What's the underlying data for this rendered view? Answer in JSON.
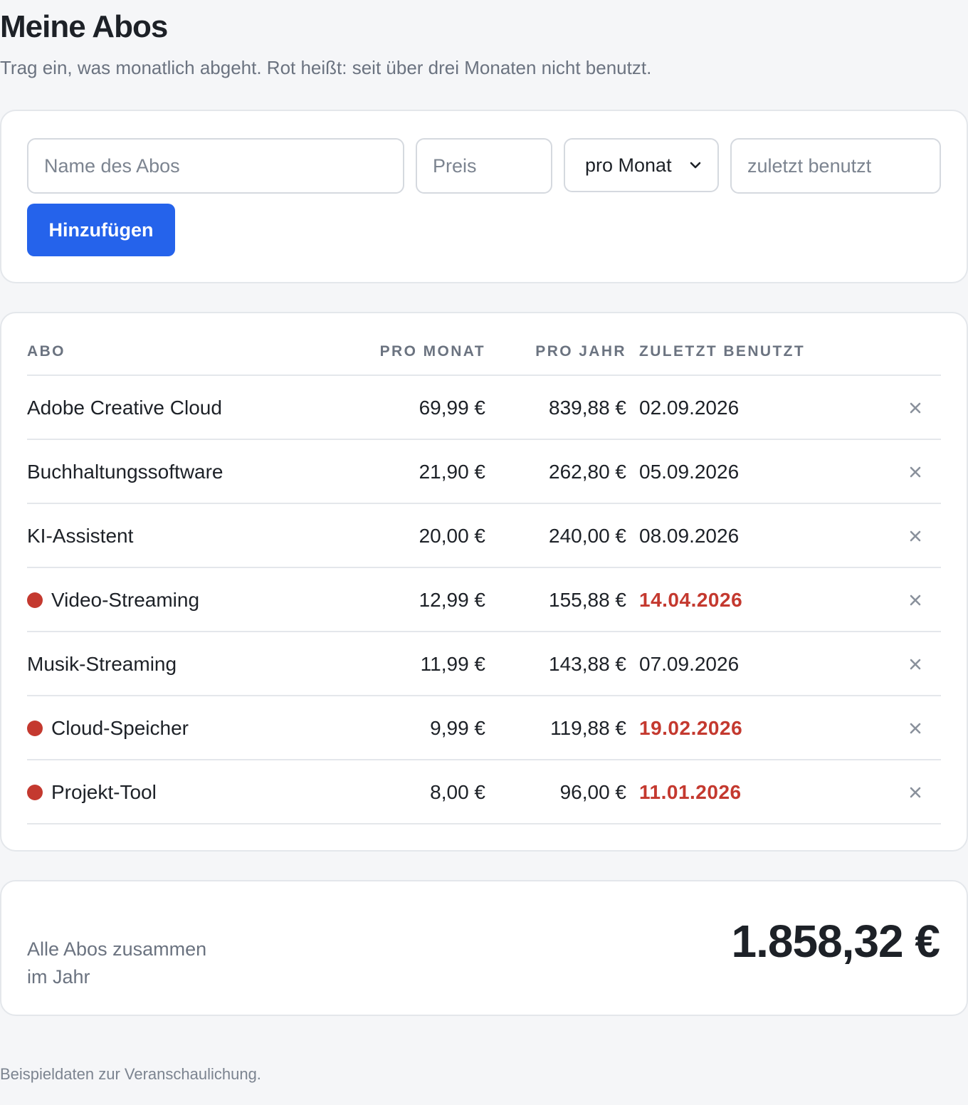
{
  "header": {
    "title": "Meine Abos",
    "subtitle": "Trag ein, was monatlich abgeht. Rot heißt: seit über drei Monaten nicht benutzt."
  },
  "form": {
    "name_placeholder": "Name des Abos",
    "price_placeholder": "Preis",
    "interval_selected": "pro Monat",
    "last_used_placeholder": "zuletzt benutzt",
    "add_label": "Hinzufügen"
  },
  "table": {
    "headers": {
      "abo": "ABO",
      "per_month": "PRO MONAT",
      "per_year": "PRO JAHR",
      "last_used": "ZULETZT BENUTZT"
    },
    "rows": [
      {
        "name": "Adobe Creative Cloud",
        "per_month": "69,99 €",
        "per_year": "839,88 €",
        "last_used": "02.09.2026",
        "stale": false
      },
      {
        "name": "Buchhaltungssoftware",
        "per_month": "21,90 €",
        "per_year": "262,80 €",
        "last_used": "05.09.2026",
        "stale": false
      },
      {
        "name": "KI-Assistent",
        "per_month": "20,00 €",
        "per_year": "240,00 €",
        "last_used": "08.09.2026",
        "stale": false
      },
      {
        "name": "Video-Streaming",
        "per_month": "12,99 €",
        "per_year": "155,88 €",
        "last_used": "14.04.2026",
        "stale": true
      },
      {
        "name": "Musik-Streaming",
        "per_month": "11,99 €",
        "per_year": "143,88 €",
        "last_used": "07.09.2026",
        "stale": false
      },
      {
        "name": "Cloud-Speicher",
        "per_month": "9,99 €",
        "per_year": "119,88 €",
        "last_used": "19.02.2026",
        "stale": true
      },
      {
        "name": "Projekt-Tool",
        "per_month": "8,00 €",
        "per_year": "96,00 €",
        "last_used": "11.01.2026",
        "stale": true
      }
    ]
  },
  "total": {
    "label_line1": "Alle Abos zusammen",
    "label_line2": "im Jahr",
    "value": "1.858,32 €"
  },
  "footnote": "Beispieldaten zur Veranschaulichung.",
  "colors": {
    "accent": "#2563eb",
    "stale": "#c4392f"
  },
  "icons": {
    "select": "chevron-down-icon",
    "delete": "close-icon",
    "stale_marker": "red-dot"
  }
}
